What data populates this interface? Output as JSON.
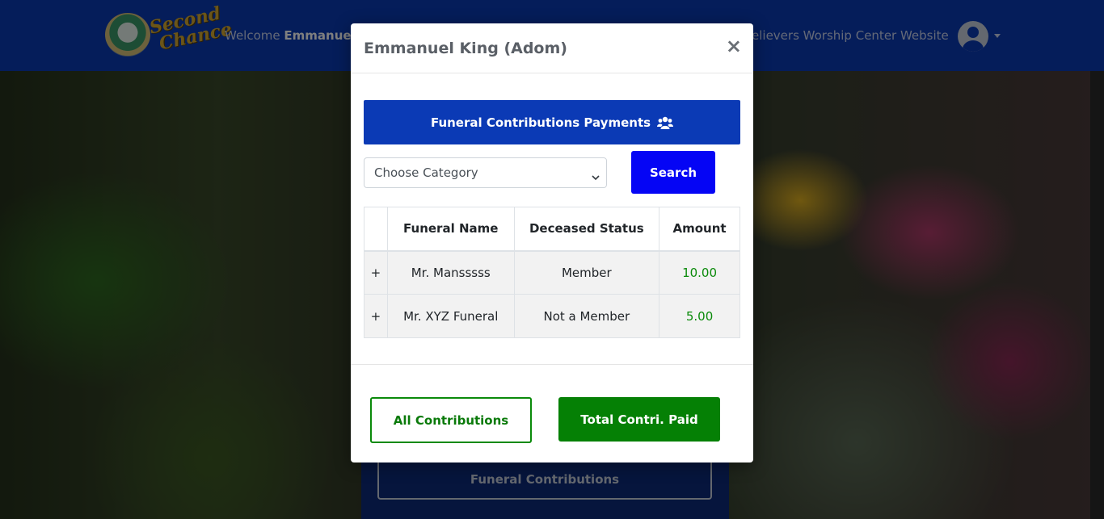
{
  "navbar": {
    "logo_text": "Second Chance",
    "welcome_prefix": "Welcome",
    "welcome_name": "Emmanuel",
    "site_link": "elievers Worship Center Website",
    "avatar_icon": "user-circle-icon",
    "brand_color": "#0b3ab5"
  },
  "background_card": {
    "button_label": "Funeral Contributions"
  },
  "modal": {
    "title": "Emmanuel King (Adom)",
    "close_glyph": "×",
    "banner_label": "Funeral Contributions Payments",
    "banner_icon": "users-icon",
    "category_select": {
      "selected": "Choose Category"
    },
    "search_label": "Search",
    "table": {
      "headers": [
        "",
        "Funeral Name",
        "Deceased Status",
        "Amount"
      ],
      "rows": [
        {
          "expand": "+",
          "name": "Mr. Mansssss",
          "status": "Member",
          "amount": "10.00"
        },
        {
          "expand": "+",
          "name": "Mr. XYZ Funeral",
          "status": "Not a Member",
          "amount": "5.00"
        }
      ]
    },
    "all_contributions_label": "All Contributions",
    "total_paid_label": "Total Contri. Paid"
  },
  "colors": {
    "banner": "#0b3ab5",
    "search": "#0505f5",
    "success": "#058005"
  }
}
